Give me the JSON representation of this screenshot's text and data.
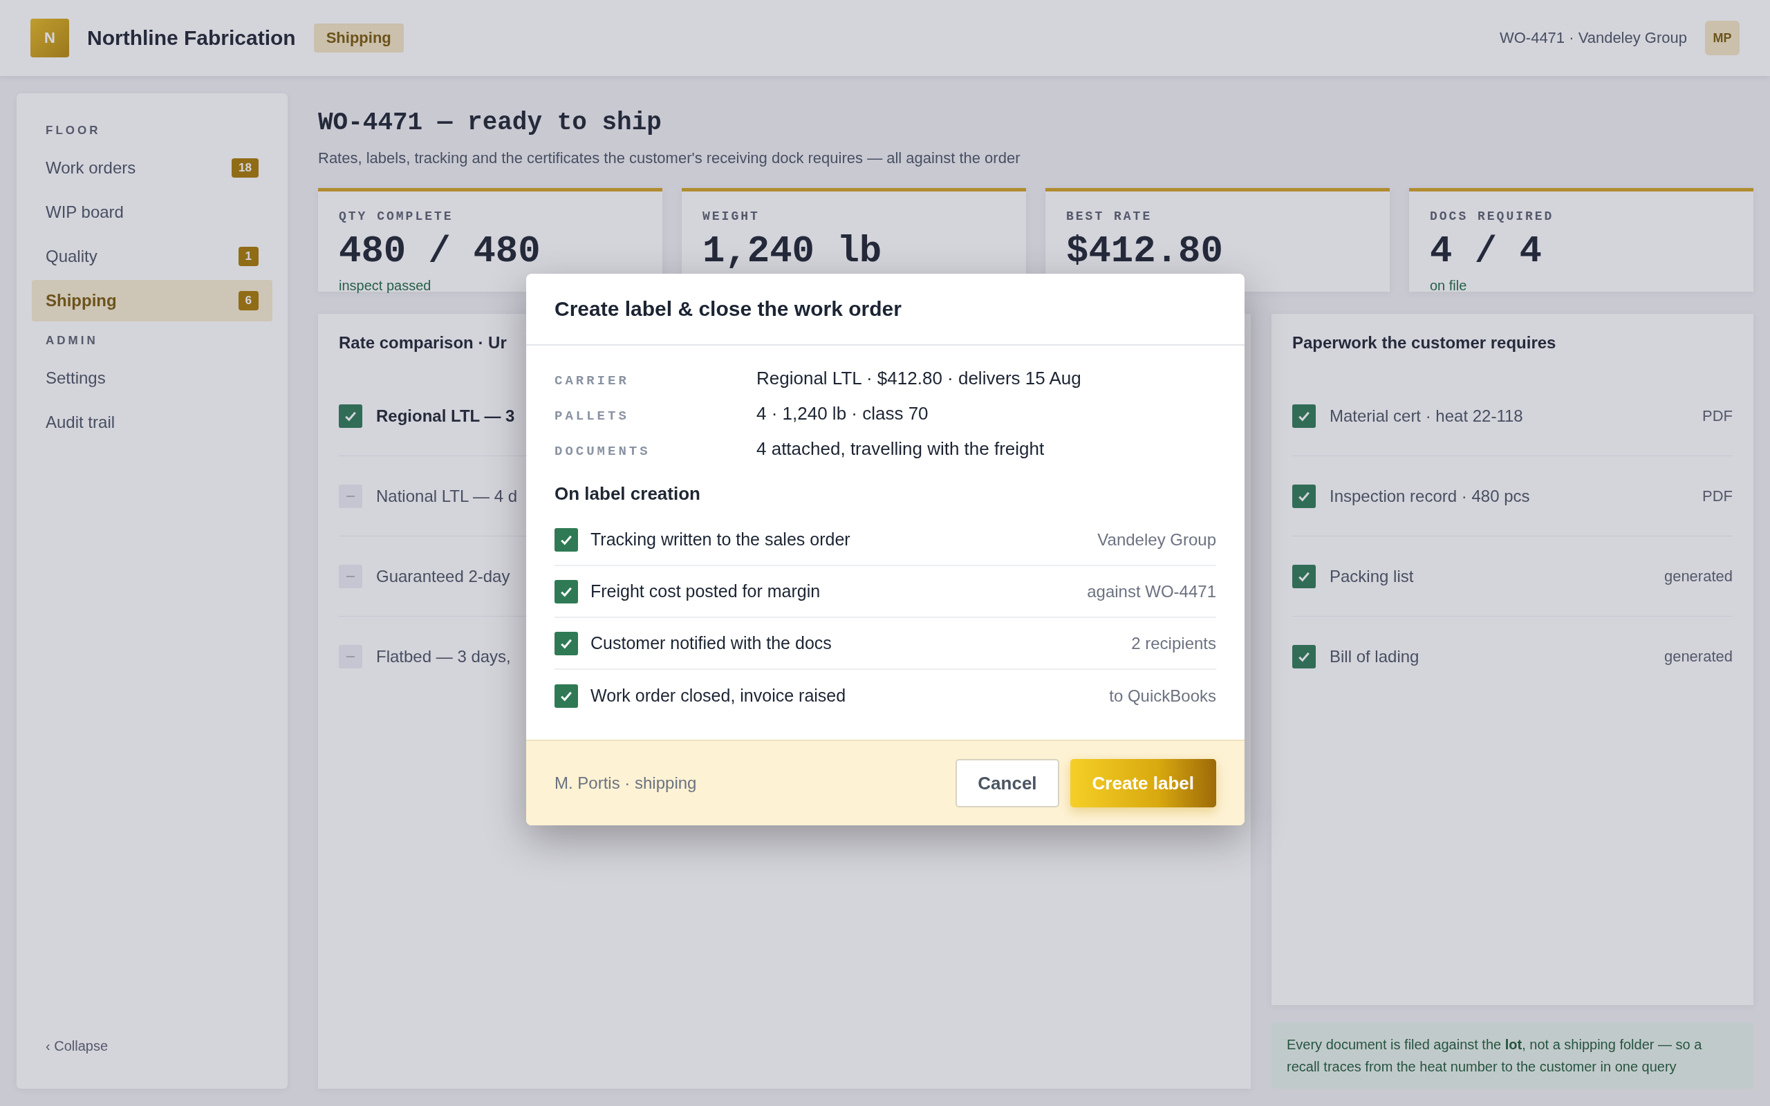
{
  "topbar": {
    "logo": "N",
    "company": "Northline Fabrication",
    "section": "Shipping",
    "context": "WO-4471 · Vandeley Group",
    "avatar": "MP"
  },
  "sidebar": {
    "groups": [
      {
        "heading": "FLOOR",
        "items": [
          {
            "label": "Work orders",
            "badge": "18",
            "selected": false
          },
          {
            "label": "WIP board",
            "selected": false
          },
          {
            "label": "Quality",
            "badge": "1",
            "selected": false
          },
          {
            "label": "Shipping",
            "badge": "6",
            "selected": true
          }
        ]
      },
      {
        "heading": "ADMIN",
        "items": [
          {
            "label": "Settings",
            "selected": false
          },
          {
            "label": "Audit trail",
            "selected": false
          }
        ]
      }
    ],
    "collapse": "‹ Collapse"
  },
  "page": {
    "title": "WO-4471 — ready to ship",
    "subtitle": "Rates, labels, tracking and the certificates the customer's receiving dock requires — all against the order"
  },
  "stats": [
    {
      "label": "QTY COMPLETE",
      "value": "480 / 480",
      "note": "inspect passed"
    },
    {
      "label": "WEIGHT",
      "value": "1,240 lb"
    },
    {
      "label": "BEST RATE",
      "value": "$412.80"
    },
    {
      "label": "DOCS REQUIRED",
      "value": "4 / 4",
      "note": "on file"
    }
  ],
  "rates": {
    "title": "Rate comparison · Ur",
    "options": [
      {
        "label": "Regional LTL — 3",
        "selected": true
      },
      {
        "label": "National LTL — 4 d",
        "selected": false
      },
      {
        "label": "Guaranteed 2-day",
        "selected": false
      },
      {
        "label": "Flatbed — 3 days,",
        "selected": false
      }
    ]
  },
  "paperwork": {
    "title": "Paperwork the customer requires",
    "items": [
      {
        "label": "Material cert · heat 22-118",
        "meta": "PDF",
        "checked": true
      },
      {
        "label": "Inspection record · 480 pcs",
        "meta": "PDF",
        "checked": true
      },
      {
        "label": "Packing list",
        "meta": "generated",
        "checked": true
      },
      {
        "label": "Bill of lading",
        "meta": "generated",
        "checked": true
      }
    ]
  },
  "note": "Every document is filed against the **lot**, not a shipping folder — so a recall traces from the heat number to the customer in one query",
  "dialog": {
    "title": "Create label & close the work order",
    "summary": [
      {
        "label": "CARRIER",
        "value": "Regional LTL · $412.80 · delivers 15 Aug"
      },
      {
        "label": "PALLETS",
        "value": "4 · 1,240 lb · class 70"
      },
      {
        "label": "DOCUMENTS",
        "value": "4 attached, travelling with the freight"
      }
    ],
    "actions_heading": "On label creation",
    "actions": [
      {
        "label": "Tracking written to the sales order",
        "meta": "Vandeley Group",
        "checked": true
      },
      {
        "label": "Freight cost posted for margin",
        "meta": "against WO-4471",
        "checked": true
      },
      {
        "label": "Customer notified with the docs",
        "meta": "2 recipients",
        "checked": true
      },
      {
        "label": "Work order closed, invoice raised",
        "meta": "to QuickBooks",
        "checked": true
      }
    ],
    "footer_note": "M. Portis · shipping",
    "buttons": [
      {
        "label": "Cancel",
        "kind": "secondary"
      },
      {
        "label": "Create label",
        "kind": "primary"
      }
    ]
  }
}
